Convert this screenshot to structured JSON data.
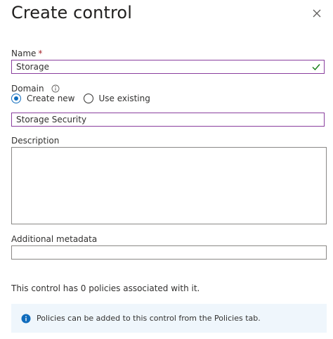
{
  "panel": {
    "title": "Create control"
  },
  "name": {
    "label": "Name",
    "required_mark": "*",
    "value": "Storage"
  },
  "domain": {
    "label": "Domain",
    "options": [
      "Create new",
      "Use existing"
    ],
    "selected": "Create new",
    "value": "Storage Security"
  },
  "description": {
    "label": "Description",
    "value": ""
  },
  "metadata": {
    "label": "Additional metadata",
    "value": ""
  },
  "policies_summary": "This control has 0 policies associated with it.",
  "info_banner": {
    "text": "Policies can be added to this control from the Policies tab."
  },
  "colors": {
    "accent": "#0f6cbd",
    "focus_border": "#8a3f9e",
    "valid": "#107c10",
    "banner_bg": "#eff6fc"
  }
}
